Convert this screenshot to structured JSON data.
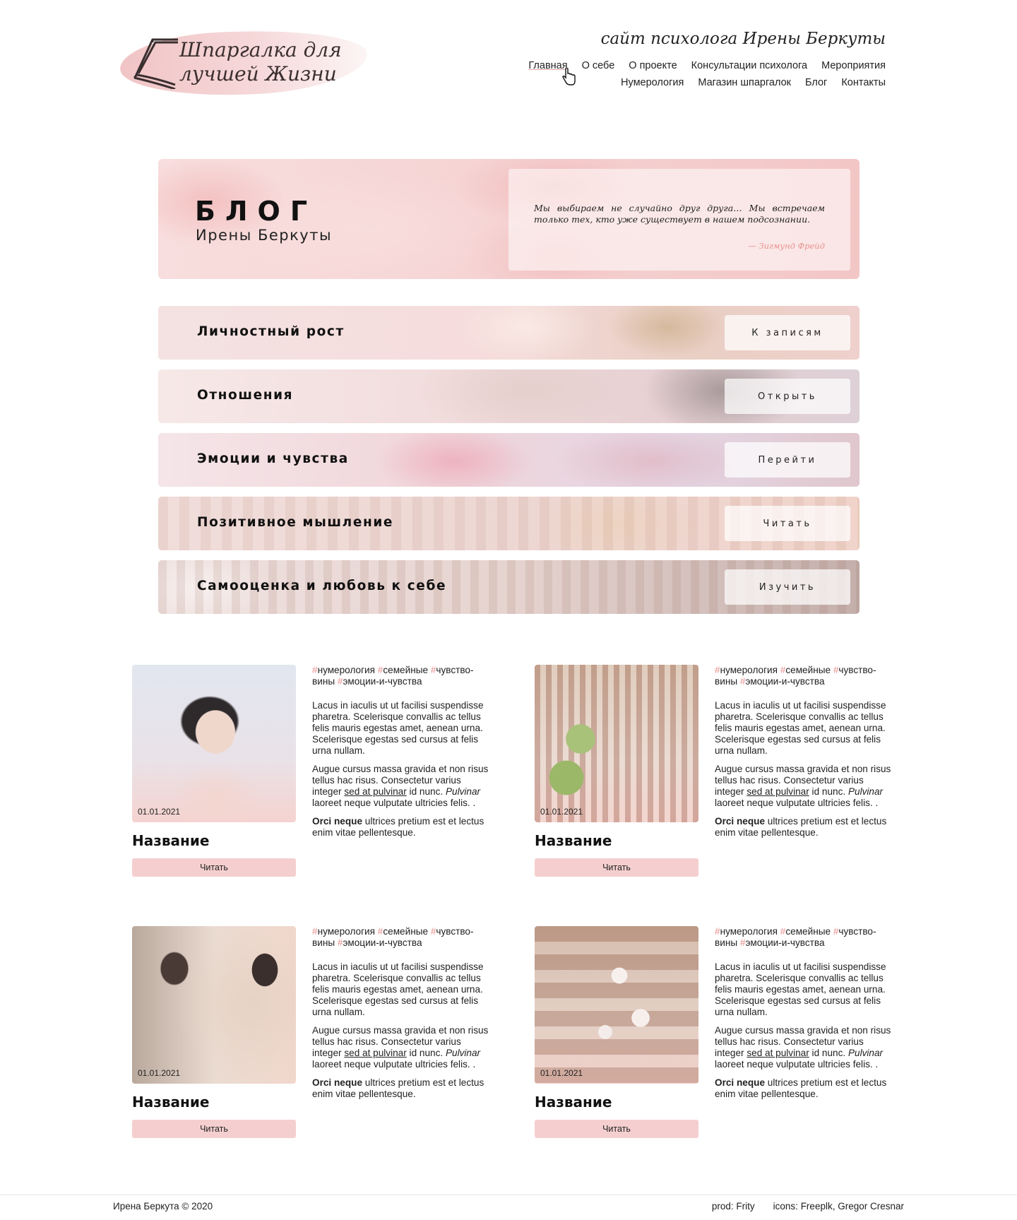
{
  "header": {
    "logo_text": "Шпаргалка для лучшей Жизни",
    "subtitle": "сайт психолога Ирены Беркуты",
    "nav_row1": [
      "Главная",
      "О себе",
      "О проекте",
      "Консультации психолога",
      "Мероприятия"
    ],
    "nav_row2": [
      "Нумерология",
      "Магазин шпаргалок",
      "Блог",
      "Контакты"
    ],
    "active_item": "Главная"
  },
  "hero": {
    "title": "БЛОГ",
    "subtitle": "Ирены Беркуты",
    "quote": "Мы выбираем не случайно друг друга… Мы встречаем только тех, кто уже существует в нашем подсознании.",
    "quote_author": "—  Зигмунд Фрейд"
  },
  "categories": [
    {
      "label": "Личностный рост",
      "button": "К записям"
    },
    {
      "label": "Отношения",
      "button": "Открыть"
    },
    {
      "label": "Эмоции и чувства",
      "button": "Перейти"
    },
    {
      "label": "Позитивное мышление",
      "button": "Читать"
    },
    {
      "label": "Самооценка и любовь к себе",
      "button": "Изучить"
    }
  ],
  "post_common": {
    "tags": [
      "нумерология",
      "семейные",
      "чувство-вины",
      "эмоции-и-чувства"
    ],
    "hash": "#",
    "p1": "Lacus in iaculis ut ut facilisi suspendisse pharetra. Scelerisque convallis ac tellus felis mauris egestas amet, aenean urna. Scelerisque egestas sed cursus at felis urna nullam.",
    "p2_a": "Augue cursus massa gravida et non risus tellus hac risus. Consectetur varius integer ",
    "p2_link": "sed at pulvinar",
    "p2_b": " id nunc. ",
    "p2_em": "Pulvinar",
    "p2_c": " laoreet neque vulputate ultricies felis. .",
    "p3_strong": "Orci neque",
    "p3_rest": " ultrices pretium est et lectus enim vitae pellentesque."
  },
  "posts": [
    {
      "date": "01.01.2021",
      "title": "Название",
      "button": "Читать"
    },
    {
      "date": "01.01.2021",
      "title": "Название",
      "button": "Читать"
    },
    {
      "date": "01.01.2021",
      "title": "Название",
      "button": "Читать"
    },
    {
      "date": "01.01.2021",
      "title": "Название",
      "button": "Читать"
    }
  ],
  "footer": {
    "copyright": "Ирена Беркута © 2020",
    "prod": "prod: Frity",
    "icons": "icons: Freeplk, Gregor Cresnar"
  },
  "colors": {
    "accent_pink": "#f5cfcf",
    "hash_color": "#e8928f"
  }
}
